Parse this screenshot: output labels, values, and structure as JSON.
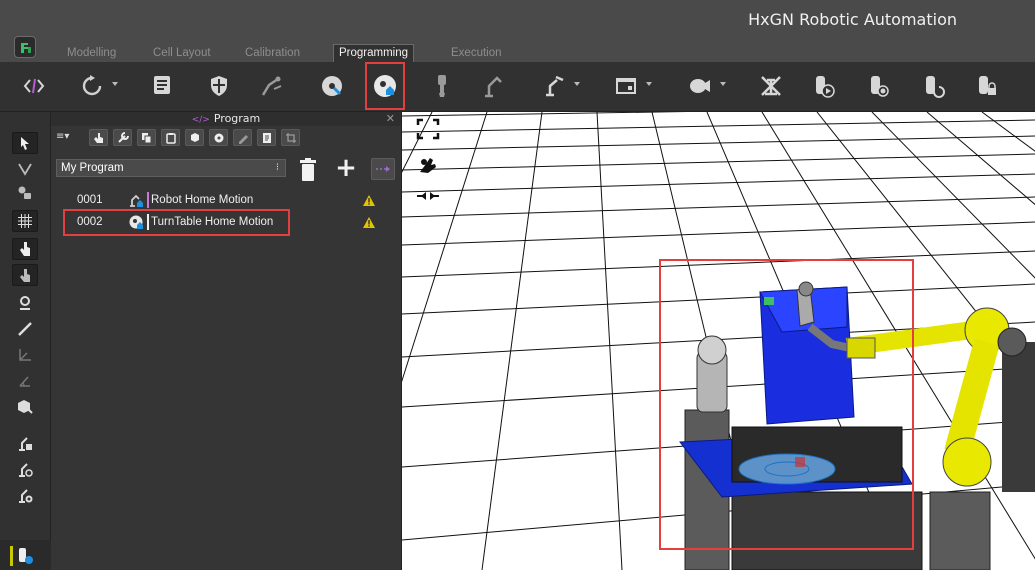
{
  "app": {
    "title": "HxGN Robotic Automation"
  },
  "tabs": [
    {
      "label": "Modelling"
    },
    {
      "label": "Cell Layout"
    },
    {
      "label": "Calibration"
    },
    {
      "label": "Programming",
      "active": true
    },
    {
      "label": "Execution"
    }
  ],
  "toolbar": {
    "icons": [
      "code-icon",
      "rotate-icon",
      "list-icon",
      "shield-icon",
      "robot-arm-icon",
      "turntable-icon",
      "turntable-home-icon",
      "gripper-icon",
      "robot-icon",
      "robot-motion-icon",
      "window-icon",
      "camera-icon",
      "disable-icon",
      "tool-play-icon",
      "tool-record-icon",
      "tool-refresh-icon",
      "tool-lock-icon"
    ],
    "highlighted": "turntable-home-icon"
  },
  "program_panel": {
    "title": "Program",
    "selected_program": "My Program",
    "rows": [
      {
        "number": "0001",
        "label": "Robot Home Motion",
        "bar_color": "#c77ad8",
        "warning": true
      },
      {
        "number": "0002",
        "label": "TurnTable Home Motion",
        "bar_color": "#f0f0f0",
        "warning": true
      }
    ]
  },
  "colors": {
    "highlight": "#e24040",
    "accent_blue": "#1f8fe0",
    "warning": "#e2c400"
  }
}
